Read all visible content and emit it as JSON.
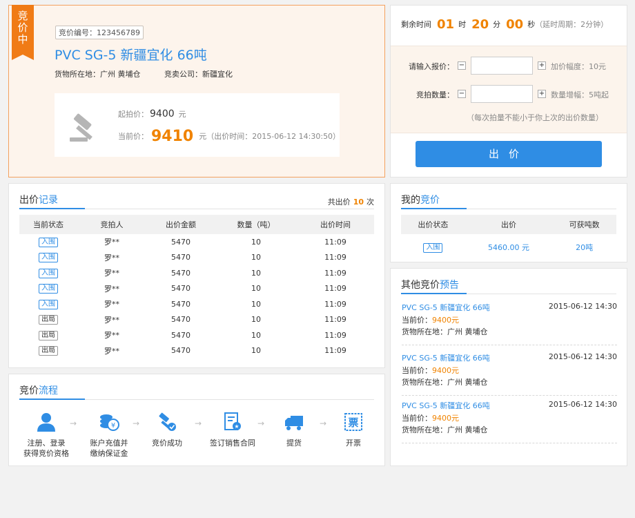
{
  "product": {
    "badge": [
      "竞",
      "价",
      "中"
    ],
    "bid_no": "竞价编号：123456789",
    "title": "PVC SG-5 新疆宜化 66吨",
    "location": "货物所在地：广州  黄埔仓",
    "company": "竞卖公司：新疆宜化",
    "start_label": "起拍价：",
    "start_price": "9400",
    "unit": "元",
    "current_label": "当前价：",
    "current_price": "9410",
    "current_unit_note": "元（出价时间：2015-06-12 14:30:50）"
  },
  "timer": {
    "label": "剩余时间",
    "hours": "01",
    "hours_unit": "时",
    "minutes": "20",
    "minutes_unit": "分",
    "seconds": "00",
    "seconds_unit": "秒",
    "note": "（延时周期：2分钟）"
  },
  "form": {
    "price_label": "请输入报价：",
    "price_note": "加价幅度：10元",
    "qty_label": "竞拍数量：",
    "qty_note": "数量增幅：5吨起",
    "minus": "−",
    "plus": "+",
    "hint": "（每次拍量不能小于你上次的出价数量）",
    "submit": "出价"
  },
  "records": {
    "title_a": "出价",
    "title_b": "记录",
    "total_pre": "共出价",
    "total_n": "10",
    "total_post": "次",
    "headers": [
      "当前状态",
      "竞拍人",
      "出价金额",
      "数量（吨）",
      "出价时间"
    ],
    "rows": [
      {
        "status": "入围",
        "bidder": "罗**",
        "amount": "5470",
        "qty": "10",
        "time": "11:09"
      },
      {
        "status": "入围",
        "bidder": "罗**",
        "amount": "5470",
        "qty": "10",
        "time": "11:09"
      },
      {
        "status": "入围",
        "bidder": "罗**",
        "amount": "5470",
        "qty": "10",
        "time": "11:09"
      },
      {
        "status": "入围",
        "bidder": "罗**",
        "amount": "5470",
        "qty": "10",
        "time": "11:09"
      },
      {
        "status": "入围",
        "bidder": "罗**",
        "amount": "5470",
        "qty": "10",
        "time": "11:09"
      },
      {
        "status": "出局",
        "bidder": "罗**",
        "amount": "5470",
        "qty": "10",
        "time": "11:09"
      },
      {
        "status": "出局",
        "bidder": "罗**",
        "amount": "5470",
        "qty": "10",
        "time": "11:09"
      },
      {
        "status": "出局",
        "bidder": "罗**",
        "amount": "5470",
        "qty": "10",
        "time": "11:09"
      }
    ]
  },
  "mybids": {
    "title_a": "我的",
    "title_b": "竞价",
    "headers": [
      "出价状态",
      "出价",
      "可获吨数"
    ],
    "row": {
      "status": "入围",
      "price": "5460.00 元",
      "tons": "20吨"
    }
  },
  "flow": {
    "title_a": "竞价",
    "title_b": "流程",
    "steps": [
      {
        "line1": "注册、登录",
        "line2": "获得竞价资格",
        "icon": "user-icon"
      },
      {
        "line1": "账户充值并",
        "line2": "缴纳保证金",
        "icon": "coins-icon"
      },
      {
        "line1": "竞价成功",
        "line2": "",
        "icon": "gavel-check-icon"
      },
      {
        "line1": "签订销售合同",
        "line2": "",
        "icon": "contract-icon"
      },
      {
        "line1": "提货",
        "line2": "",
        "icon": "truck-icon"
      },
      {
        "line1": "开票",
        "line2": "",
        "icon": "invoice-icon"
      }
    ]
  },
  "others": {
    "title_a": "其他竞价",
    "title_b": "预告",
    "items": [
      {
        "title": "PVC SG-5 新疆宜化 66吨",
        "time": "2015-06-12 14:30",
        "price_label": "当前价：",
        "price": "9400元",
        "location": "货物所在地：广州  黄埔仓"
      },
      {
        "title": "PVC SG-5 新疆宜化 66吨",
        "time": "2015-06-12 14:30",
        "price_label": "当前价：",
        "price": "9400元",
        "location": "货物所在地：广州  黄埔仓"
      },
      {
        "title": "PVC SG-5 新疆宜化 66吨",
        "time": "2015-06-12 14:30",
        "price_label": "当前价：",
        "price": "9400元",
        "location": "货物所在地：广州  黄埔仓"
      }
    ]
  },
  "colors": {
    "accent": "#2f8de4",
    "orange": "#f08300",
    "badge": "#f07b16"
  }
}
